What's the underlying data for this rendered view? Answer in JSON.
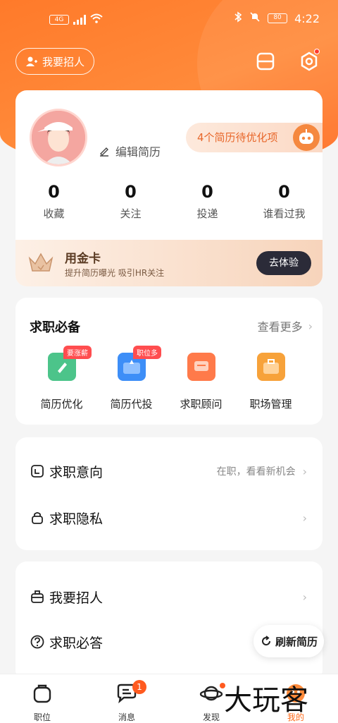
{
  "status_bar": {
    "network": "4G",
    "battery": "80",
    "time": "4:22"
  },
  "header": {
    "recruit_label": "我要招人"
  },
  "profile": {
    "edit_label": "编辑简历",
    "optimize_label": "4个简历待优化项",
    "stats": [
      {
        "value": "0",
        "label": "收藏"
      },
      {
        "value": "0",
        "label": "关注"
      },
      {
        "value": "0",
        "label": "投递"
      },
      {
        "value": "0",
        "label": "谁看过我"
      }
    ],
    "gold_card": {
      "title": "用金卡",
      "subtitle": "提升简历曝光 吸引HR关注",
      "button": "去体验"
    }
  },
  "tools_section": {
    "title": "求职必备",
    "more": "查看更多",
    "items": [
      {
        "label": "简历优化",
        "tag": "要涨薪",
        "color": "#4cc48a"
      },
      {
        "label": "简历代投",
        "tag": "职位多",
        "color": "#3d8ef7"
      },
      {
        "label": "求职顾问",
        "tag": "",
        "color": "#ff7a4a"
      },
      {
        "label": "职场管理",
        "tag": "",
        "color": "#f7a23a"
      }
    ]
  },
  "list1": [
    {
      "label": "求职意向",
      "right": "在职，看看新机会",
      "icon": "intent-icon"
    },
    {
      "label": "求职隐私",
      "right": "",
      "icon": "privacy-lock-icon"
    }
  ],
  "list2": [
    {
      "label": "我要招人",
      "right": "",
      "icon": "recruit-briefcase-icon"
    },
    {
      "label": "求职必答",
      "right": "",
      "icon": "question-icon"
    }
  ],
  "refresh_label": "刷新简历",
  "tabs": [
    {
      "label": "职位",
      "badge": ""
    },
    {
      "label": "消息",
      "badge": "1"
    },
    {
      "label": "发现",
      "badge": ""
    },
    {
      "label": "我的",
      "badge": ""
    }
  ],
  "watermark": "大玩客"
}
